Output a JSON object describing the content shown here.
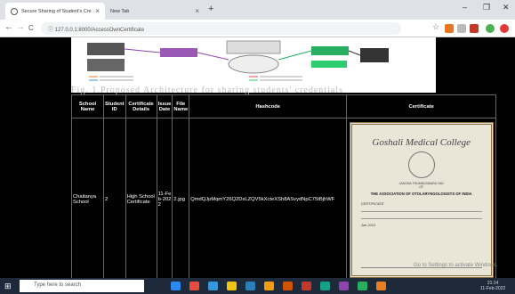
{
  "browser": {
    "tabs": [
      {
        "title": "Secure Sharing of Student's Cre",
        "active": true
      },
      {
        "title": "New Tab",
        "active": false
      }
    ],
    "url": "127.0.0.1:8000/AccessOwnCertificate",
    "window_controls": {
      "minimize": "–",
      "maximize": "❐",
      "close": "✕"
    },
    "back": "←",
    "forward": "→",
    "reload": "C"
  },
  "figure": {
    "caption": "Fig. 1.Proposed Architecture for sharing students' credentials"
  },
  "table": {
    "headers": [
      "School Name",
      "Student ID",
      "Certificate Details",
      "Issue Date",
      "File Name",
      "Hashcode",
      "Certificate"
    ],
    "rows": [
      {
        "school_name": "Chaitanya School",
        "student_id": "2",
        "certificate_details": "High School Certificate",
        "issue_date": "11-Feb-2022",
        "file_name": "2.jpg",
        "hashcode": "QmdQJpMqmY26Q2DxLZQV5kXcteXSh8ASvydNpC75tBjhWF"
      }
    ]
  },
  "certificate_image": {
    "line1": "Goshali Medical College",
    "line2": "JANGNA THUMBUSWARA YAD",
    "line3": "OF",
    "line4": "THE ASSOCIATION OF OTOLARYNGOLOGISTS OF INDIA",
    "line5": "CERTIFICATE",
    "line6": "Jan 2013"
  },
  "watermark": "Go to Settings to activate Windows.",
  "taskbar": {
    "search_placeholder": "Type here to search",
    "time": "21:14",
    "date": "11-Feb-2022"
  }
}
